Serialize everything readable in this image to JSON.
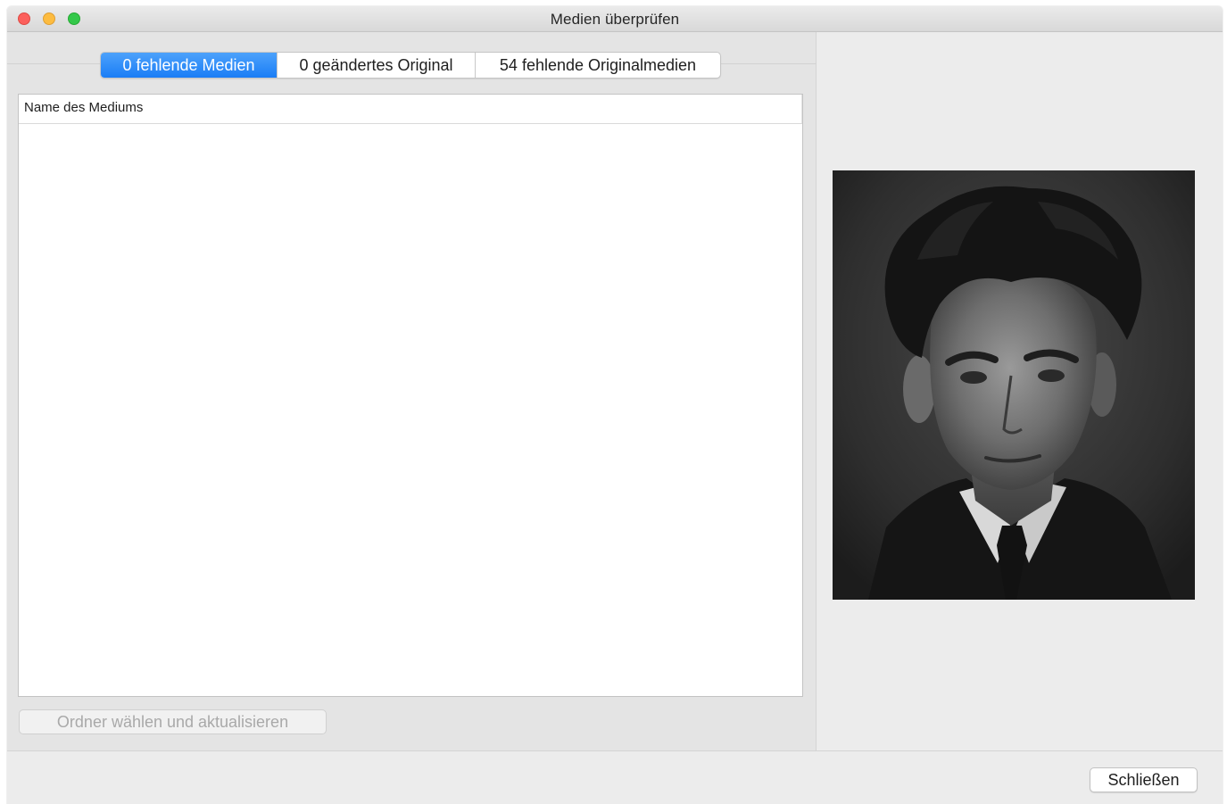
{
  "window": {
    "title": "Medien überprüfen"
  },
  "tabs": [
    {
      "label": "0 fehlende Medien",
      "selected": true
    },
    {
      "label": "0 geändertes Original",
      "selected": false
    },
    {
      "label": "54 fehlende Originalmedien",
      "selected": false
    }
  ],
  "table": {
    "columns": [
      "Name des Mediums"
    ],
    "rows": []
  },
  "buttons": {
    "folder_label": "Ordner wählen und aktualisieren",
    "folder_enabled": false,
    "close_label": "Schließen"
  },
  "preview": {
    "description_icon": "portrait-photo"
  },
  "colors": {
    "accent": "#1a7df6",
    "close_dot": "#fc605c",
    "minimize_dot": "#fdbc40",
    "maximize_dot": "#34c84a"
  }
}
